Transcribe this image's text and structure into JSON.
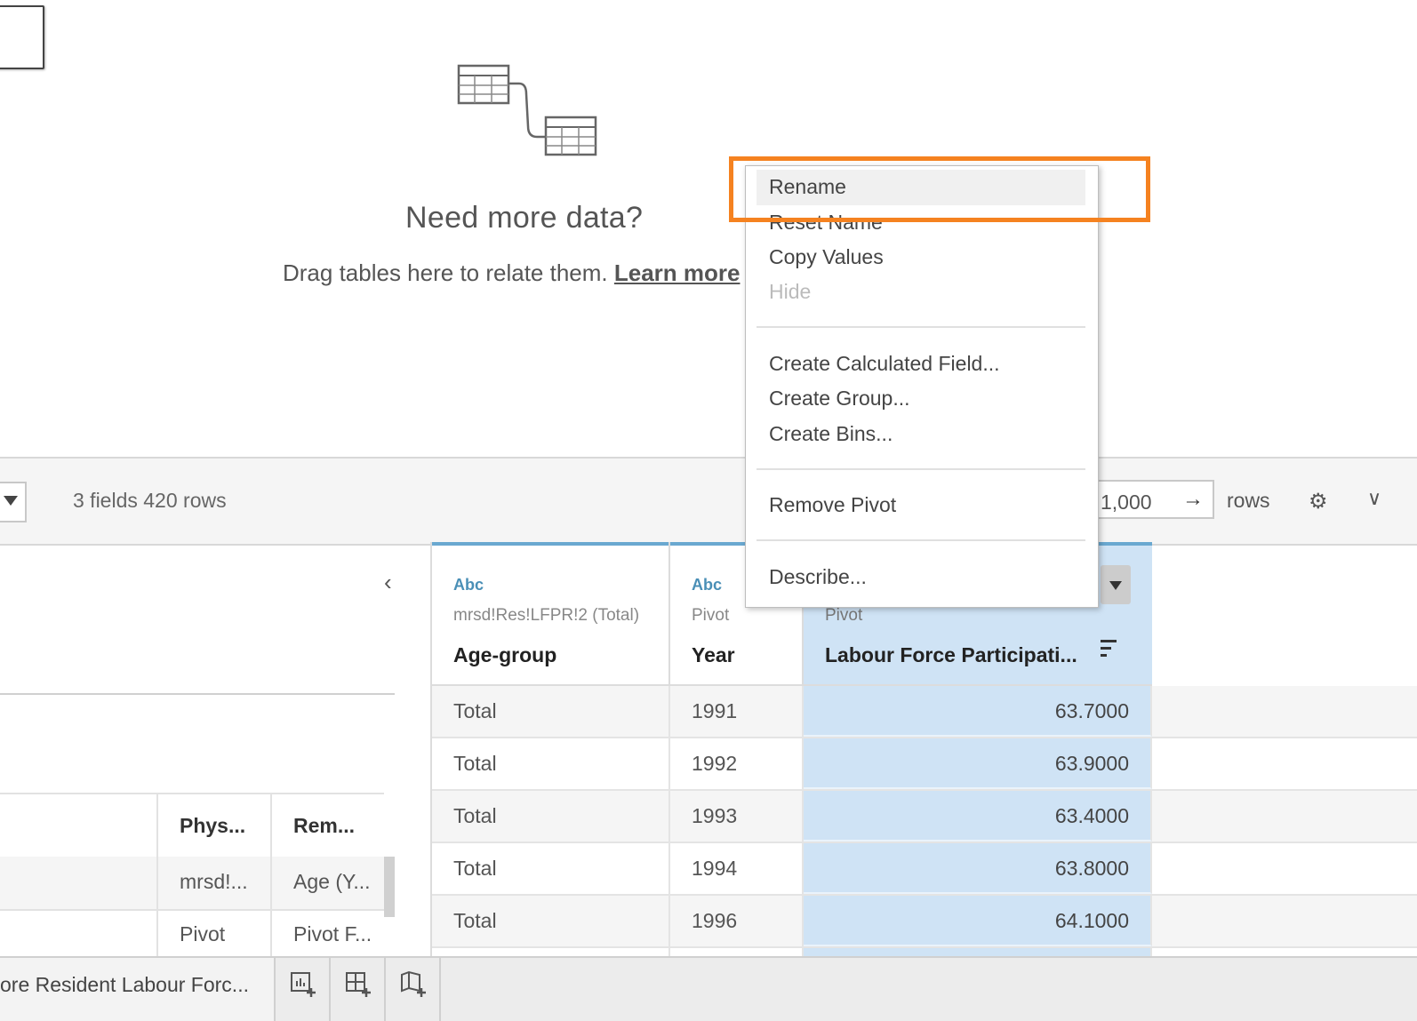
{
  "canvas": {
    "heading": "Need more data?",
    "subtext": "Drag tables here to relate them.",
    "learn_more": "Learn more"
  },
  "toolbar": {
    "fields_count": "3 fields 420 rows",
    "rows_value": "1,000",
    "rows_label": "rows"
  },
  "left_pane": {
    "headers": [
      "Phys...",
      "Rem..."
    ],
    "rows": [
      [
        "mrsd!...",
        "Age (Y..."
      ],
      [
        "Pivot",
        "Pivot F..."
      ]
    ]
  },
  "grid": {
    "columns": [
      {
        "type": "Abc",
        "source": "mrsd!Res!LFPR!2 (Total)",
        "name": "Age-group"
      },
      {
        "type": "Abc",
        "source": "Pivot",
        "name": "Year"
      },
      {
        "type": "#",
        "source": "Pivot",
        "name": "Labour Force Participati..."
      }
    ],
    "rows": [
      [
        "Total",
        "1991",
        "63.7000"
      ],
      [
        "Total",
        "1992",
        "63.9000"
      ],
      [
        "Total",
        "1993",
        "63.4000"
      ],
      [
        "Total",
        "1994",
        "63.8000"
      ],
      [
        "Total",
        "1996",
        "64.1000"
      ]
    ]
  },
  "bottom": {
    "sheet_tab": "ore Resident Labour Forc..."
  },
  "context_menu": {
    "items": [
      "Rename",
      "Reset Name",
      "Copy Values",
      "Hide",
      "Create Calculated Field...",
      "Create Group...",
      "Create Bins...",
      "Remove Pivot",
      "Describe..."
    ],
    "disabled": [
      "Hide"
    ]
  },
  "colors": {
    "highlight": "#f58220",
    "selected_column": "#cfe3f5",
    "type_label": "#4a8fb6"
  },
  "icons": [
    "join-tables-icon",
    "dropdown-arrow-icon",
    "arrow-right-icon",
    "gear-icon",
    "chevron-down-icon",
    "chevron-left-icon",
    "sort-icon",
    "new-worksheet-icon",
    "new-dashboard-icon",
    "new-story-icon"
  ]
}
